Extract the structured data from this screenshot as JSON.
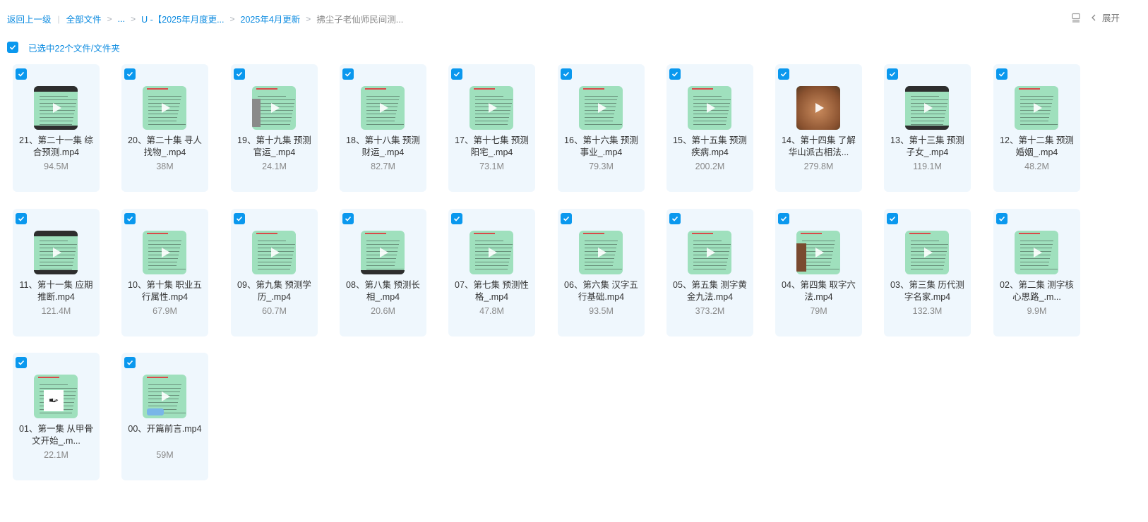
{
  "breadcrumb": {
    "back": "返回上一级",
    "all_files": "全部文件",
    "ellipsis": "...",
    "folder1": "U -【2025年月度更...",
    "folder2": "2025年4月更新",
    "current": "拂尘子老仙师民间测..."
  },
  "topbar": {
    "expand_label": "展开"
  },
  "selection": {
    "text": "已选中22个文件/文件夹"
  },
  "colors": {
    "accent": "#0a98ee",
    "card_bg": "#eff7fd",
    "thumb_green": "#9fe0bd"
  },
  "files": [
    {
      "name": "21、第二十一集 综合预测.mp4",
      "size": "94.5M",
      "thumb": "dark"
    },
    {
      "name": "20、第二十集 寻人找物_.mp4",
      "size": "38M",
      "thumb": "green"
    },
    {
      "name": "19、第十九集 预测官运_.mp4",
      "size": "24.1M",
      "thumb": "grayleft"
    },
    {
      "name": "18、第十八集 预测财运_.mp4",
      "size": "82.7M",
      "thumb": "green"
    },
    {
      "name": "17、第十七集 预测阳宅_.mp4",
      "size": "73.1M",
      "thumb": "green"
    },
    {
      "name": "16、第十六集 预测事业_.mp4",
      "size": "79.3M",
      "thumb": "green"
    },
    {
      "name": "15、第十五集 预测疾病.mp4",
      "size": "200.2M",
      "thumb": "green"
    },
    {
      "name": "14、第十四集 了解华山派古相法...",
      "size": "279.8M",
      "thumb": "face"
    },
    {
      "name": "13、第十三集 预测子女_.mp4",
      "size": "119.1M",
      "thumb": "dark"
    },
    {
      "name": "12、第十二集 预测婚姻_.mp4",
      "size": "48.2M",
      "thumb": "green"
    },
    {
      "name": "11、第十一集 应期推断.mp4",
      "size": "121.4M",
      "thumb": "dark"
    },
    {
      "name": "10、第十集 职业五行属性.mp4",
      "size": "67.9M",
      "thumb": "green"
    },
    {
      "name": "09、第九集 预测学历_.mp4",
      "size": "60.7M",
      "thumb": "green"
    },
    {
      "name": "08、第八集 预测长相_.mp4",
      "size": "20.6M",
      "thumb": "darkbot"
    },
    {
      "name": "07、第七集 预测性格_.mp4",
      "size": "47.8M",
      "thumb": "green"
    },
    {
      "name": "06、第六集 汉字五行基础.mp4",
      "size": "93.5M",
      "thumb": "green"
    },
    {
      "name": "05、第五集 测字黄金九法.mp4",
      "size": "373.2M",
      "thumb": "green"
    },
    {
      "name": "04、第四集 取字六法.mp4",
      "size": "79M",
      "thumb": "person"
    },
    {
      "name": "03、第三集 历代测字名家.mp4",
      "size": "132.3M",
      "thumb": "green"
    },
    {
      "name": "02、第二集 测字核心思路_.m...",
      "size": "9.9M",
      "thumb": "green"
    },
    {
      "name": "01、第一集 从甲骨文开始_.m...",
      "size": "22.1M",
      "thumb": "paper"
    },
    {
      "name": "00、开篇前言.mp4",
      "size": "59M",
      "thumb": "blob"
    }
  ]
}
